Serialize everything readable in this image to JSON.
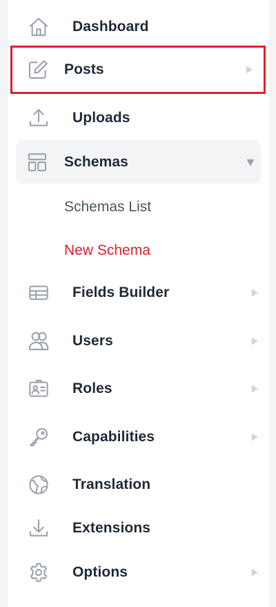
{
  "colors": {
    "icon": "#9ca3af",
    "text": "#1f2937",
    "muted": "#4b5563",
    "accent_red": "#e11d2e",
    "active_bg": "#f3f4f6",
    "chevron": "#d1d5db"
  },
  "nav": {
    "dashboard": {
      "label": "Dashboard",
      "icon": "home-icon"
    },
    "posts": {
      "label": "Posts",
      "icon": "edit-icon",
      "has_submenu": true
    },
    "uploads": {
      "label": "Uploads",
      "icon": "upload-icon"
    },
    "schemas": {
      "label": "Schemas",
      "icon": "layout-icon",
      "expanded": true,
      "children": [
        {
          "label": "Schemas List"
        },
        {
          "label": "New Schema",
          "active": true
        }
      ]
    },
    "fields_builder": {
      "label": "Fields Builder",
      "icon": "table-icon",
      "has_submenu": true
    },
    "users": {
      "label": "Users",
      "icon": "users-icon",
      "has_submenu": true
    },
    "roles": {
      "label": "Roles",
      "icon": "id-card-icon",
      "has_submenu": true
    },
    "capabilities": {
      "label": "Capabilities",
      "icon": "key-icon",
      "has_submenu": true
    },
    "translation": {
      "label": "Translation",
      "icon": "globe-icon"
    },
    "extensions": {
      "label": "Extensions",
      "icon": "download-icon"
    },
    "options": {
      "label": "Options",
      "icon": "gear-icon",
      "has_submenu": true
    }
  }
}
